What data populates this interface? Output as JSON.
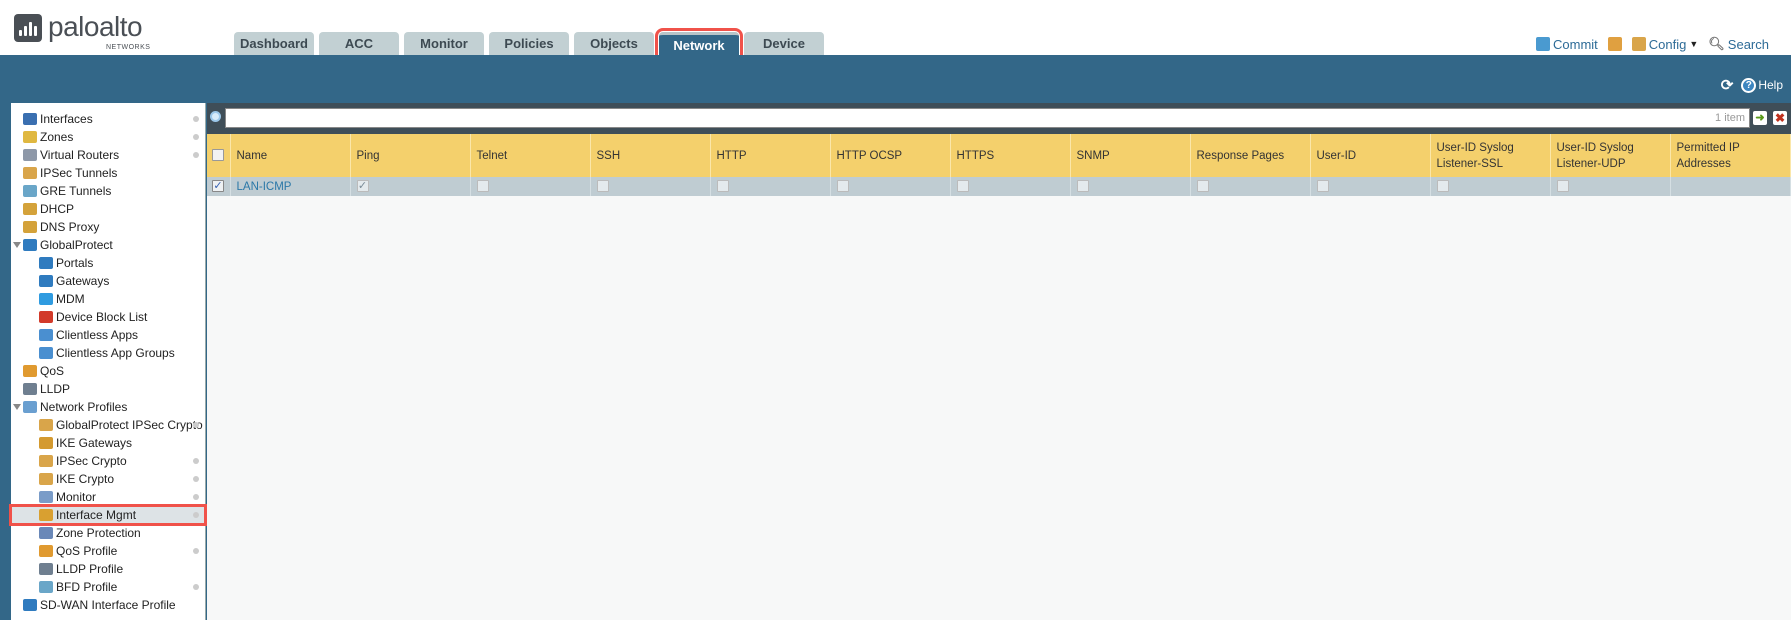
{
  "header": {
    "logo_text": "paloalto",
    "logo_sub": "NETWORKS",
    "tabs": [
      "Dashboard",
      "ACC",
      "Monitor",
      "Policies",
      "Objects",
      "Network",
      "Device"
    ],
    "active_tab": "Network",
    "links": {
      "commit": "Commit",
      "config": "Config",
      "search": "Search"
    },
    "help": "Help"
  },
  "sidebar": {
    "items": [
      {
        "label": "Interfaces",
        "level": 0,
        "icon": "interfaces-icon",
        "color": "#3a6fb0",
        "dot": true
      },
      {
        "label": "Zones",
        "level": 0,
        "icon": "zones-icon",
        "color": "#e0b840",
        "dot": true
      },
      {
        "label": "Virtual Routers",
        "level": 0,
        "icon": "virtual-router-icon",
        "color": "#8e98a8",
        "dot": true
      },
      {
        "label": "IPSec Tunnels",
        "level": 0,
        "icon": "ipsec-tunnel-icon",
        "color": "#d9a54a"
      },
      {
        "label": "GRE Tunnels",
        "level": 0,
        "icon": "gre-tunnel-icon",
        "color": "#6aa6c8"
      },
      {
        "label": "DHCP",
        "level": 0,
        "icon": "dhcp-icon",
        "color": "#d4a23a"
      },
      {
        "label": "DNS Proxy",
        "level": 0,
        "icon": "dns-proxy-icon",
        "color": "#d4a23a"
      },
      {
        "label": "GlobalProtect",
        "level": 0,
        "icon": "globalprotect-icon",
        "color": "#2f7bbf",
        "expanded": true
      },
      {
        "label": "Portals",
        "level": 1,
        "icon": "portals-icon",
        "color": "#2f7bbf"
      },
      {
        "label": "Gateways",
        "level": 1,
        "icon": "gateways-icon",
        "color": "#2f7bbf"
      },
      {
        "label": "MDM",
        "level": 1,
        "icon": "mdm-icon",
        "color": "#2f9be0"
      },
      {
        "label": "Device Block List",
        "level": 1,
        "icon": "device-block-icon",
        "color": "#d23a2a"
      },
      {
        "label": "Clientless Apps",
        "level": 1,
        "icon": "clientless-apps-icon",
        "color": "#4a8fd0"
      },
      {
        "label": "Clientless App Groups",
        "level": 1,
        "icon": "clientless-app-groups-icon",
        "color": "#4a8fd0"
      },
      {
        "label": "QoS",
        "level": 0,
        "icon": "qos-icon",
        "color": "#e09a30"
      },
      {
        "label": "LLDP",
        "level": 0,
        "icon": "lldp-icon",
        "color": "#6f7f90"
      },
      {
        "label": "Network Profiles",
        "level": 0,
        "icon": "network-profiles-icon",
        "color": "#6a9fd0",
        "expanded": true
      },
      {
        "label": "GlobalProtect IPSec Crypto",
        "level": 1,
        "icon": "lock-icon",
        "color": "#d9a54a",
        "dot": true
      },
      {
        "label": "IKE Gateways",
        "level": 1,
        "icon": "ike-gateway-icon",
        "color": "#d49a30"
      },
      {
        "label": "IPSec Crypto",
        "level": 1,
        "icon": "lock-icon",
        "color": "#d9a54a",
        "dot": true
      },
      {
        "label": "IKE Crypto",
        "level": 1,
        "icon": "lock-icon",
        "color": "#d9a54a",
        "dot": true
      },
      {
        "label": "Monitor",
        "level": 1,
        "icon": "monitor-icon",
        "color": "#7a9cc8",
        "dot": true
      },
      {
        "label": "Interface Mgmt",
        "level": 1,
        "icon": "interface-mgmt-icon",
        "color": "#d9a030",
        "dot": true,
        "selected": true
      },
      {
        "label": "Zone Protection",
        "level": 1,
        "icon": "zone-protection-icon",
        "color": "#6a88b8"
      },
      {
        "label": "QoS Profile",
        "level": 1,
        "icon": "qos-profile-icon",
        "color": "#e09a30",
        "dot": true
      },
      {
        "label": "LLDP Profile",
        "level": 1,
        "icon": "lldp-profile-icon",
        "color": "#6f7f90"
      },
      {
        "label": "BFD Profile",
        "level": 1,
        "icon": "bfd-profile-icon",
        "color": "#6aa6c8",
        "dot": true
      },
      {
        "label": "SD-WAN Interface Profile",
        "level": 0,
        "icon": "sdwan-profile-icon",
        "color": "#2f7bbf"
      }
    ]
  },
  "search": {
    "value": "",
    "count": "1 item"
  },
  "table": {
    "columns": [
      "Name",
      "Ping",
      "Telnet",
      "SSH",
      "HTTP",
      "HTTP OCSP",
      "HTTPS",
      "SNMP",
      "Response Pages",
      "User-ID",
      "User-ID Syslog Listener-SSL",
      "User-ID Syslog Listener-UDP",
      "Permitted IP Addresses"
    ],
    "rows": [
      {
        "selected": true,
        "name": "LAN-ICMP",
        "ping": true,
        "telnet": false,
        "ssh": false,
        "http": false,
        "http_ocsp": false,
        "https": false,
        "snmp": false,
        "response_pages": false,
        "user_id": false,
        "syslog_ssl": false,
        "syslog_udp": false,
        "permitted_ip": ""
      }
    ]
  },
  "colors": {
    "band": "#336788",
    "header_row": "#f4d06c",
    "data_row": "#bfccd2",
    "highlight": "#f0524a"
  }
}
